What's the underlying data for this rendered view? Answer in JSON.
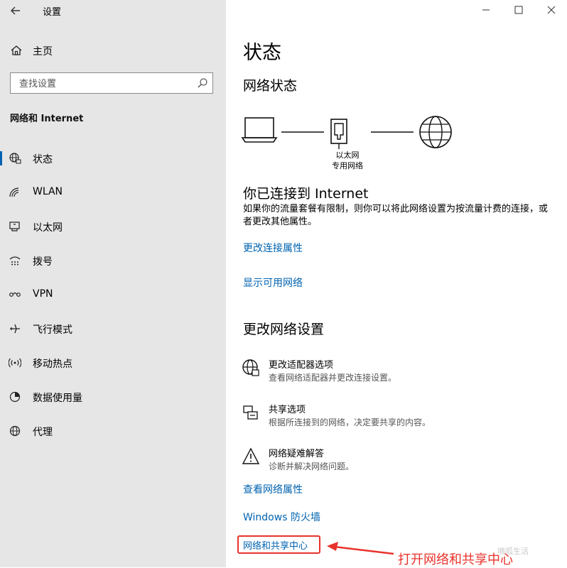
{
  "window": {
    "title": "设置",
    "controls": [
      "minimize",
      "maximize",
      "close"
    ]
  },
  "sidebar": {
    "home_label": "主页",
    "search_placeholder": "查找设置",
    "section_title": "网络和 Internet",
    "items": [
      {
        "label": "状态",
        "icon": "globe-status-icon",
        "active": true
      },
      {
        "label": "WLAN",
        "icon": "wifi-icon",
        "active": false
      },
      {
        "label": "以太网",
        "icon": "ethernet-icon",
        "active": false
      },
      {
        "label": "拨号",
        "icon": "dialup-icon",
        "active": false
      },
      {
        "label": "VPN",
        "icon": "vpn-icon",
        "active": false
      },
      {
        "label": "飞行模式",
        "icon": "airplane-icon",
        "active": false
      },
      {
        "label": "移动热点",
        "icon": "hotspot-icon",
        "active": false
      },
      {
        "label": "数据使用量",
        "icon": "data-usage-icon",
        "active": false
      },
      {
        "label": "代理",
        "icon": "proxy-globe-icon",
        "active": false
      }
    ]
  },
  "main": {
    "page_title": "状态",
    "network_status_heading": "网络状态",
    "diagram": {
      "adapter_name": "以太网",
      "network_name": "专用网络"
    },
    "connected_heading": "你已连接到 Internet",
    "connected_desc": "如果你的流量套餐有限制，则你可以将此网络设置为按流量计费的连接，或者更改其他属性。",
    "links_top": [
      "更改连接属性",
      "显示可用网络"
    ],
    "change_settings_heading": "更改网络设置",
    "settings": [
      {
        "title": "更改适配器选项",
        "desc": "查看网络适配器并更改连接设置。",
        "icon": "adapter-globe-icon"
      },
      {
        "title": "共享选项",
        "desc": "根据所连接到的网络，决定要共享的内容。",
        "icon": "sharing-icon"
      },
      {
        "title": "网络疑难解答",
        "desc": "诊断并解决网络问题。",
        "icon": "warning-icon"
      }
    ],
    "links_bottom": [
      "查看网络属性",
      "Windows 防火墙",
      "网络和共享中心"
    ]
  },
  "annotation": {
    "text": "打开网络和共享中心",
    "color": "#e8332c"
  },
  "watermark": "嘀呱生活",
  "colors": {
    "accent": "#0063b1",
    "sidebar_bg": "#e6e6e6",
    "annotation": "#e8332c"
  }
}
